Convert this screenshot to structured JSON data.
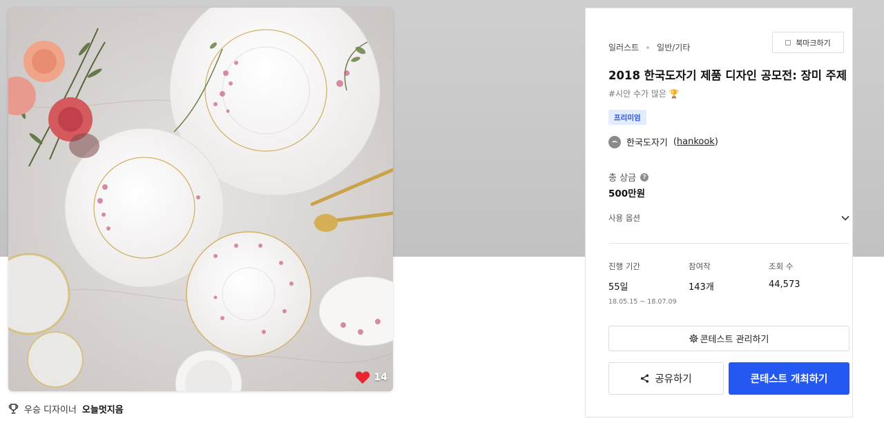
{
  "contest": {
    "category": "일러스트",
    "subcategory": "일반/기타",
    "bookmark_label": "북마크하기",
    "title": "2018 한국도자기 제품 디자인 공모전: 장미 주제",
    "tag": "#시안 수가 많은 🏆",
    "premium_label": "프리미엄",
    "host_name": "한국도자기",
    "host_handle": "hankook",
    "prize_label": "총 상금",
    "prize_value": "500만원",
    "usage_label": "사용 옵션"
  },
  "stats": {
    "period_label": "진행 기간",
    "period_value": "55일",
    "period_range": "18.05.15 ~ 18.07.09",
    "participants_label": "참여작",
    "participants_value": "143개",
    "views_label": "조회 수",
    "views_value": "44,573"
  },
  "actions": {
    "manage_label": "콘테스트 관리하기",
    "share_label": "공유하기",
    "host_label": "콘테스트 개최하기"
  },
  "image": {
    "likes": "14"
  },
  "winner": {
    "prefix": "우승 디자이너",
    "name": "오늘멋지음"
  },
  "colors": {
    "primary_button": "#2359f2",
    "premium_badge_bg": "#e3ecff",
    "premium_badge_text": "#2d55d8",
    "heart": "#e8262e"
  },
  "icons": [
    "bookmark-icon",
    "help-icon",
    "chevron-down-icon",
    "gear-icon",
    "share-icon",
    "heart-icon",
    "trophy-icon",
    "avatar"
  ]
}
